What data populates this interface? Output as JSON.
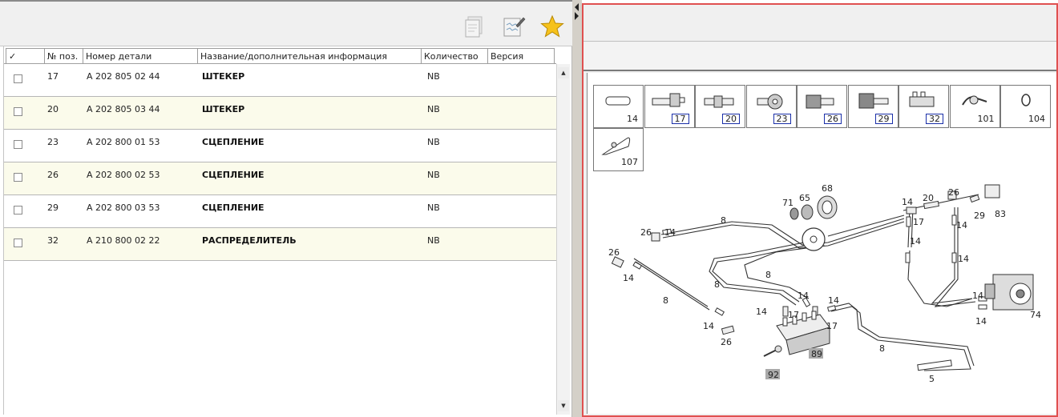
{
  "toolbar": {
    "icons": [
      "copy-document-icon",
      "edit-document-icon",
      "favorite-star-icon"
    ]
  },
  "table": {
    "columns": {
      "check": "✓",
      "pos": "№ поз.",
      "part_number": "Номер детали",
      "name": "Название/дополнительная информация",
      "quantity": "Количество",
      "version": "Версия"
    },
    "rows": [
      {
        "pos": "17",
        "part_number": "A 202 805 02 44",
        "name": "ШТЕКЕР",
        "quantity": "NB",
        "version": ""
      },
      {
        "pos": "20",
        "part_number": "A 202 805 03 44",
        "name": "ШТЕКЕР",
        "quantity": "NB",
        "version": ""
      },
      {
        "pos": "23",
        "part_number": "A 202 800 01 53",
        "name": "СЦЕПЛЕНИЕ",
        "quantity": "NB",
        "version": ""
      },
      {
        "pos": "26",
        "part_number": "A 202 800 02 53",
        "name": "СЦЕПЛЕНИЕ",
        "quantity": "NB",
        "version": ""
      },
      {
        "pos": "29",
        "part_number": "A 202 800 03 53",
        "name": "СЦЕПЛЕНИЕ",
        "quantity": "NB",
        "version": ""
      },
      {
        "pos": "32",
        "part_number": "A 210 800 02 22",
        "name": "РАСПРЕДЕЛИТЕЛЬ",
        "quantity": "NB",
        "version": ""
      }
    ]
  },
  "drawing": {
    "legend_parts": [
      {
        "num": "14",
        "highlighted": false
      },
      {
        "num": "17",
        "highlighted": true
      },
      {
        "num": "20",
        "highlighted": true
      },
      {
        "num": "23",
        "highlighted": true
      },
      {
        "num": "26",
        "highlighted": true
      },
      {
        "num": "29",
        "highlighted": true
      },
      {
        "num": "32",
        "highlighted": true
      },
      {
        "num": "101",
        "highlighted": false
      },
      {
        "num": "104",
        "highlighted": false
      },
      {
        "num": "107",
        "highlighted": false
      }
    ],
    "callouts": {
      "c68": "68",
      "c71": "71",
      "c65": "65",
      "c14a": "14",
      "c20a": "20",
      "c26a": "26",
      "c17a": "17",
      "c29a": "29",
      "c83": "83",
      "c14b": "14",
      "c8a": "8",
      "c26b": "26",
      "c14c": "14",
      "c14d": "14",
      "c14e": "14",
      "c26c": "26",
      "c14f": "14",
      "c8b": "8",
      "c8c": "8",
      "c8d": "8",
      "c14g": "14",
      "c14h": "14",
      "c14i": "14",
      "c17b": "17",
      "c17c": "17",
      "c14j": "14",
      "c14k": "14",
      "c74": "74",
      "c8e": "8",
      "c14l": "14",
      "c26d": "26",
      "c89": "89",
      "c92": "92",
      "c5": "5"
    }
  }
}
